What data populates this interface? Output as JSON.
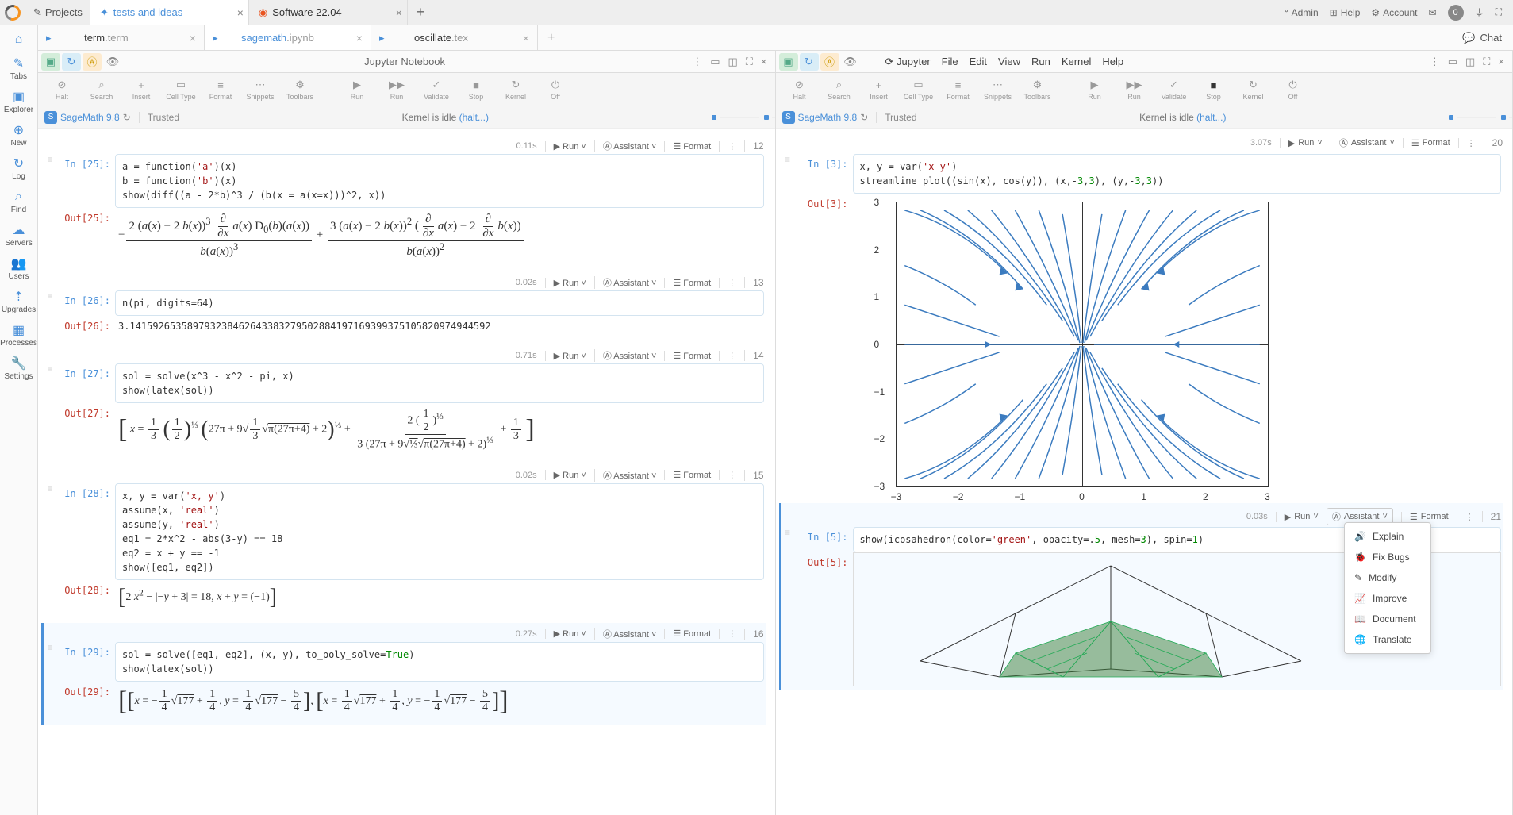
{
  "topbar": {
    "projects": "Projects",
    "tab1_label": "tests and ideas",
    "tab2_label": "Software 22.04",
    "admin": "Admin",
    "help": "Help",
    "account": "Account",
    "badge": "0"
  },
  "vbar": {
    "tabs": "Tabs",
    "explorer": "Explorer",
    "new": "New",
    "log": "Log",
    "find": "Find",
    "servers": "Servers",
    "users": "Users",
    "upgrades": "Upgrades",
    "processes": "Processes",
    "settings": "Settings"
  },
  "filetabs": {
    "t1_base": "term",
    "t1_ext": ".term",
    "t2_base": "sagemath",
    "t2_ext": ".ipynb",
    "t3_base": "oscillate",
    "t3_ext": ".tex",
    "chat": "Chat"
  },
  "panel_left": {
    "title": "Jupyter Notebook",
    "kernel": "SageMath 9.8",
    "trusted": "Trusted",
    "kernel_status": "Kernel is idle",
    "kernel_link": "(halt...)"
  },
  "panel_right": {
    "menu": {
      "jupyter": "Jupyter",
      "file": "File",
      "edit": "Edit",
      "view": "View",
      "run": "Run",
      "kernel": "Kernel",
      "help": "Help"
    },
    "kernel": "SageMath 9.8",
    "trusted": "Trusted",
    "kernel_status": "Kernel is idle",
    "kernel_link": "(halt...)"
  },
  "toolbar": {
    "halt": "Halt",
    "search": "Search",
    "insert": "Insert",
    "celltype": "Cell Type",
    "format": "Format",
    "snippets": "Snippets",
    "toolbars": "Toolbars",
    "run": "Run",
    "stop": "Stop",
    "validate": "Validate",
    "kernel": "Kernel",
    "off": "Off"
  },
  "cell_actions": {
    "run": "Run",
    "assistant": "Assistant",
    "format": "Format"
  },
  "cells_left": [
    {
      "in_label": "In [25]:",
      "out_label": "Out[25]:",
      "time": "0.11s",
      "num": "12",
      "code": "a = function('a')(x)\nb = function('b')(x)\nshow(diff((a - 2*b)^3 / (b(x = a(x=x)))^2, x))",
      "output_math": "-\\frac{2(a(x)-2b(x))^3 \\frac{\\partial}{\\partial x}a(x) D_0(b)(a(x))}{b(a(x))^3} + \\frac{3(a(x)-2b(x))^2(\\frac{\\partial}{\\partial x}a(x)-2\\frac{\\partial}{\\partial x}b(x))}{b(a(x))^2}"
    },
    {
      "in_label": "In [26]:",
      "out_label": "Out[26]:",
      "time": "0.02s",
      "num": "13",
      "code": "n(pi, digits=64)",
      "output_text": "3.141592653589793238462643383279502884197169399375105820974944592"
    },
    {
      "in_label": "In [27]:",
      "out_label": "Out[27]:",
      "time": "0.71s",
      "num": "14",
      "code": "sol = solve(x^3 - x^2 - pi, x)\nshow(latex(sol))",
      "output_math": "[ x = 1/3 (1/2)^{1/3} (27\\pi + 9\\sqrt{1/3}\\sqrt{\\pi(27\\pi+4)}+2)^{1/3} + 2(1/2)^{1/3} / (3(27\\pi+9\\sqrt{1/3}\\sqrt{\\pi(27\\pi+4)}+2)^{1/3}) + 1/3 ]"
    },
    {
      "in_label": "In [28]:",
      "out_label": "Out[28]:",
      "time": "0.02s",
      "num": "15",
      "code": "x, y = var('x, y')\nassume(x, 'real')\nassume(y, 'real')\neq1 = 2*x^2 - abs(3-y) == 18\neq2 = x + y == -1\nshow([eq1, eq2])",
      "output_math": "[2x^2 - |-y+3| = 18, x+y = (-1)]"
    },
    {
      "in_label": "In [29]:",
      "out_label": "Out[29]:",
      "time": "0.27s",
      "num": "16",
      "selected": true,
      "code": "sol = solve([eq1, eq2], (x, y), to_poly_solve=True)\nshow(latex(sol))",
      "output_math": "[[x = -1/4\\sqrt{177}+1/4, y = 1/4\\sqrt{177}-5/4], [x = 1/4\\sqrt{177}+1/4, y = -1/4\\sqrt{177}-5/4]]"
    }
  ],
  "cells_right": {
    "top_time": "3.07s",
    "top_num": "20",
    "cell3": {
      "in_label": "In [3]:",
      "out_label": "Out[3]:",
      "code": "x, y = var('x y')\nstreamline_plot((sin(x), cos(y)), (x,-3,3), (y,-3,3))"
    },
    "cell5": {
      "in_label": "In [5]:",
      "out_label": "Out[5]:",
      "time": "0.03s",
      "num": "21",
      "code": "show(icosahedron(color='green', opacity=.5, mesh=3), spin=1)"
    }
  },
  "context_menu": {
    "explain": "Explain",
    "fixbugs": "Fix Bugs",
    "modify": "Modify",
    "improve": "Improve",
    "document": "Document",
    "translate": "Translate"
  },
  "chart_data": {
    "type": "streamline",
    "field": "(sin(x), cos(y))",
    "xlim": [
      -3,
      3
    ],
    "ylim": [
      -3,
      3
    ],
    "xticks": [
      -3,
      -2,
      -1,
      0,
      1,
      2,
      3
    ],
    "yticks": [
      -3,
      -2,
      -1,
      0,
      1,
      2,
      3
    ]
  }
}
